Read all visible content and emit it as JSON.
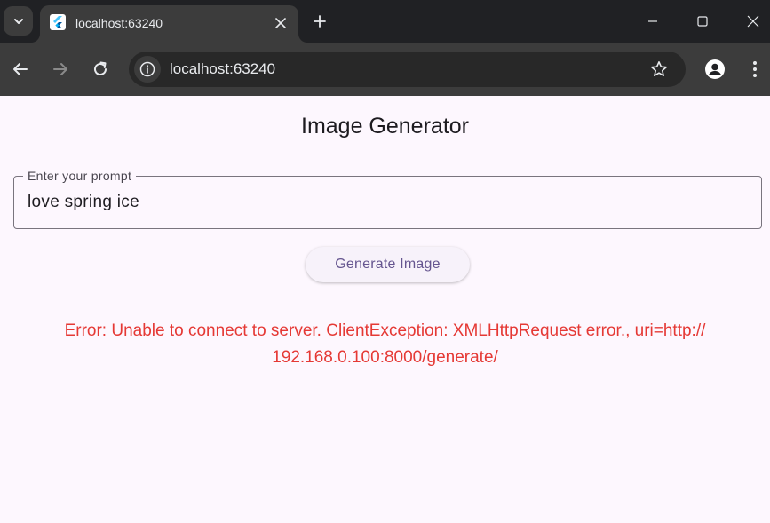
{
  "browser": {
    "tab": {
      "title": "localhost:63240"
    },
    "url": "localhost:63240"
  },
  "app": {
    "title": "Image Generator",
    "prompt_field": {
      "label": "Enter your prompt",
      "value": "love spring ice"
    },
    "generate_button_label": "Generate Image",
    "error_line_1": "Error: Unable to connect to server. ClientException: XMLHttpRequest error., uri=http://",
    "error_line_2": "192.168.0.100:8000/generate/"
  },
  "colors": {
    "error": "#e53935",
    "button_text": "#65558f",
    "page_background": "#fdf7fe"
  },
  "icons": [
    "tab-search-icon",
    "flutter-favicon-icon",
    "close-icon",
    "plus-icon",
    "minimize-icon",
    "maximize-icon",
    "window-close-icon",
    "back-icon",
    "forward-icon",
    "reload-icon",
    "site-info-icon",
    "star-icon",
    "profile-icon",
    "kebab-menu-icon"
  ]
}
